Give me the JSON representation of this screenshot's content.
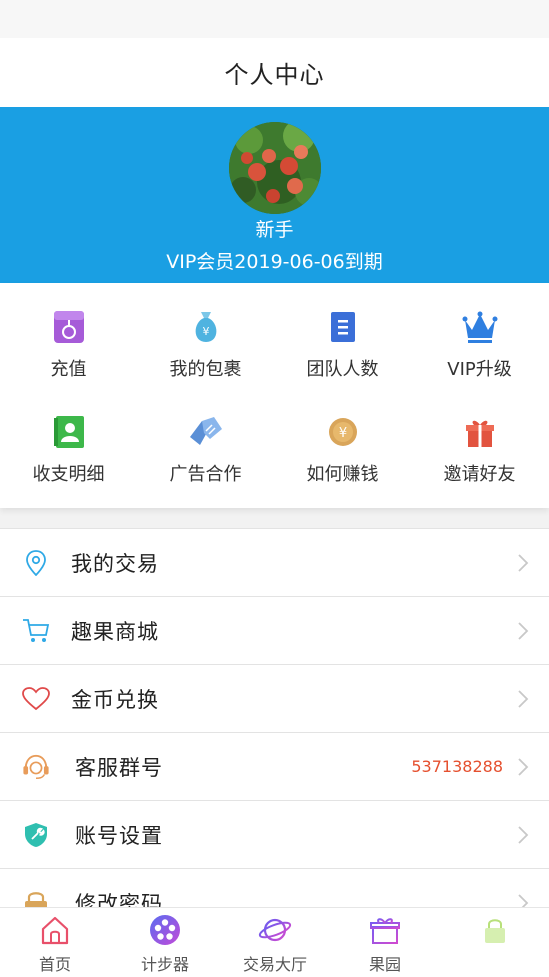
{
  "header": {
    "title": "个人中心"
  },
  "profile": {
    "nickname": "新手",
    "vip_expiry": "VIP会员2019-06-06到期"
  },
  "quick_actions": [
    {
      "label": "充值",
      "icon": "wallet-icon"
    },
    {
      "label": "我的包裹",
      "icon": "money-bag-icon"
    },
    {
      "label": "团队人数",
      "icon": "document-icon"
    },
    {
      "label": "VIP升级",
      "icon": "crown-icon"
    },
    {
      "label": "收支明细",
      "icon": "contact-book-icon"
    },
    {
      "label": "广告合作",
      "icon": "handshake-icon"
    },
    {
      "label": "如何赚钱",
      "icon": "coin-icon"
    },
    {
      "label": "邀请好友",
      "icon": "gift-icon"
    }
  ],
  "menu": [
    {
      "label": "我的交易",
      "value": "",
      "icon": "location-pin-icon"
    },
    {
      "label": "趣果商城",
      "value": "",
      "icon": "shopping-cart-icon"
    },
    {
      "label": "金币兑换",
      "value": "",
      "icon": "heart-icon"
    },
    {
      "label": "客服群号",
      "value": "537138288",
      "icon": "headset-icon"
    },
    {
      "label": "账号设置",
      "value": "",
      "icon": "wrench-shield-icon"
    },
    {
      "label": "修改密码",
      "value": "",
      "icon": "lock-icon"
    }
  ],
  "tabbar": [
    {
      "label": "首页",
      "icon": "home-icon"
    },
    {
      "label": "计步器",
      "icon": "film-reel-icon"
    },
    {
      "label": "交易大厅",
      "icon": "planet-icon"
    },
    {
      "label": "果园",
      "icon": "gift-box-icon"
    },
    {
      "label": "",
      "icon": "lock-icon"
    }
  ],
  "colors": {
    "accent": "#1a9fe3",
    "value_red": "#e5502f"
  }
}
